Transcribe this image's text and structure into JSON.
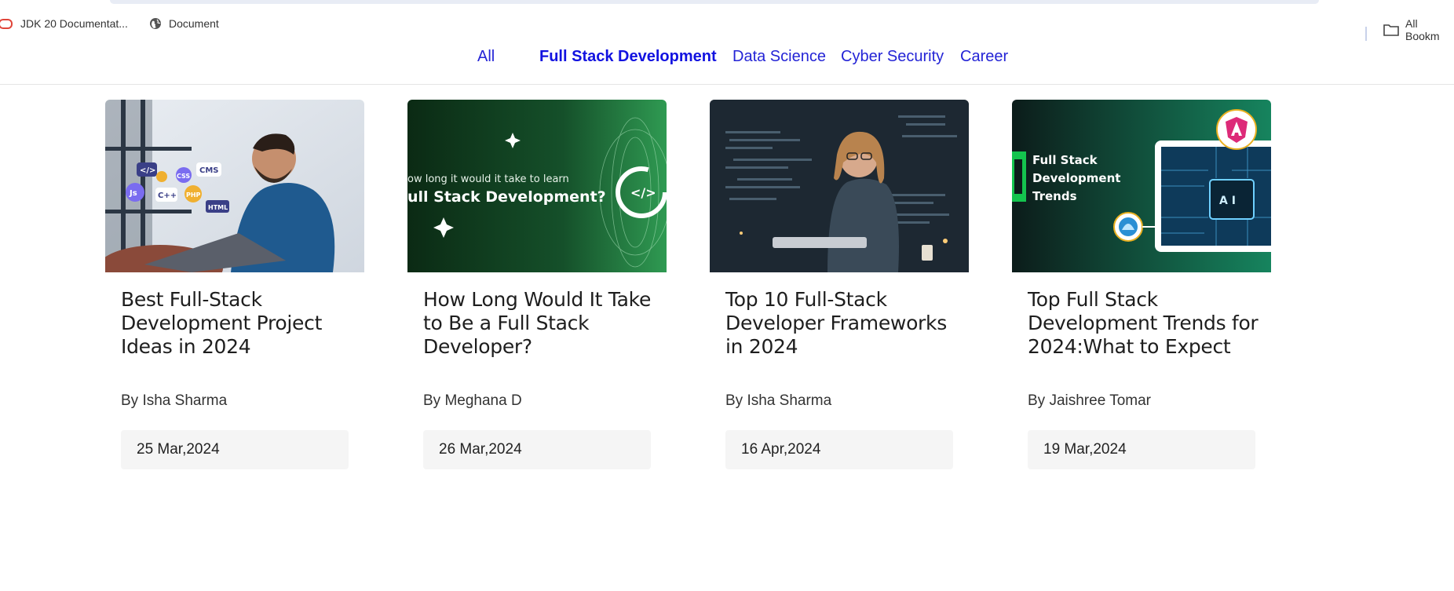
{
  "bookmarks": {
    "items": [
      {
        "label": "JDK 20 Documentat...",
        "icon": "oracle-icon"
      },
      {
        "label": "Document",
        "icon": "globe-icon"
      }
    ],
    "all_bookmarks": {
      "label": "All Bookm",
      "icon": "folder-icon"
    }
  },
  "categories": [
    {
      "label": "All",
      "active": false
    },
    {
      "label": "Full Stack Development",
      "active": true
    },
    {
      "label": "Data Science",
      "active": false
    },
    {
      "label": "Cyber Security",
      "active": false
    },
    {
      "label": "Career",
      "active": false
    }
  ],
  "cards": [
    {
      "title": "Best Full-Stack Development Project Ideas in 2024",
      "author": "By Isha Sharma",
      "date": "25 Mar,2024",
      "thumb": {
        "badges": [
          "</>",
          "CMS",
          "CSS",
          "Js",
          "C++",
          "PHP",
          "HTML"
        ]
      }
    },
    {
      "title": "How Long Would It Take to Be a Full Stack Developer?",
      "author": "By Meghana D",
      "date": "26 Mar,2024",
      "thumb": {
        "line1": "ow long it would it take to learn",
        "line2": "ull Stack Development?",
        "code_glyph": "</>"
      }
    },
    {
      "title": "Top 10 Full-Stack Developer Frameworks in 2024",
      "author": "By Isha Sharma",
      "date": "16 Apr,2024",
      "thumb": {}
    },
    {
      "title": "Top Full Stack Development Trends for 2024:What to Expect",
      "author": "By Jaishree Tomar",
      "date": "19 Mar,2024",
      "thumb": {
        "lines": [
          "Full Stack",
          "Development",
          "Trends"
        ],
        "chip_label": "A I"
      }
    }
  ],
  "colors": {
    "link": "#2424d6",
    "active_link": "#1212e0",
    "date_bg": "#f5f5f5"
  }
}
